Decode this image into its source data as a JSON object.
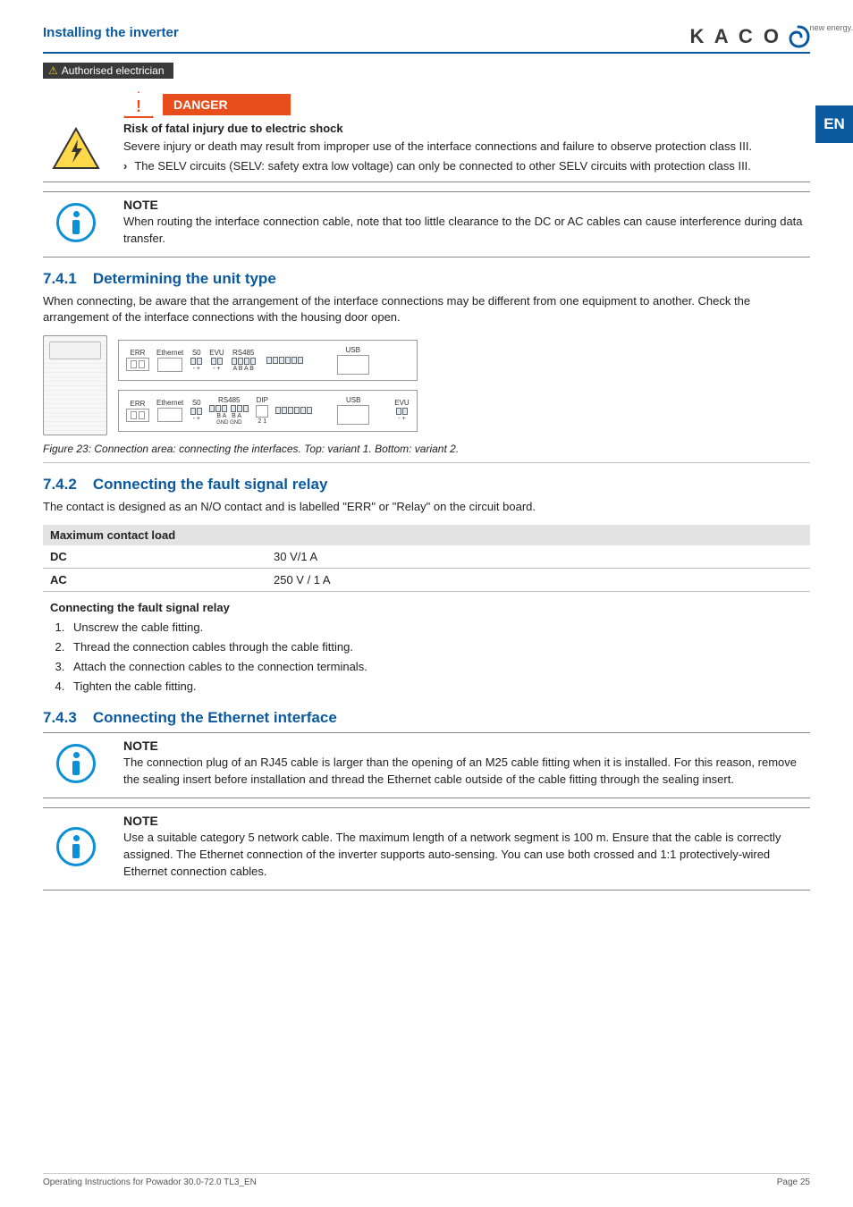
{
  "header": {
    "section_title": "Installing the inverter",
    "logo_text": "K A C O",
    "logo_sub": "new energy.",
    "lang_tab": "EN"
  },
  "auth_badge": "Authorised electrician",
  "danger": {
    "label": "DANGER",
    "heading": "Risk of fatal injury due to electric shock",
    "para": "Severe injury or death may result from improper use of the interface connections and failure to observe protection class III.",
    "bullet": "The SELV circuits (SELV: safety extra low voltage) can only be connected to other SELV circuits with protection class III."
  },
  "note_route": {
    "title": "NOTE",
    "text": "When routing the interface connection cable, note that too little clearance to the DC or AC cables can cause interference during data transfer."
  },
  "sec_741": {
    "num": "7.4.1",
    "title": "Determining the unit type",
    "para": "When connecting, be aware that the arrangement of the interface connections may be different from one equipment to another. Check the arrangement of the interface connections with the housing door open.",
    "fig_caption": "Figure 23: Connection area: connecting the interfaces. Top: variant 1. Bottom: variant 2.",
    "labels1": {
      "err": "ERR",
      "eth": "Ethernet",
      "s0": "S0",
      "evu": "EVU",
      "rs": "RS485",
      "usb": "USB",
      "sub": "-  +    -  +   A B A B"
    },
    "labels2": {
      "err": "ERR",
      "eth": "Ethernet",
      "s0": "S0",
      "rs": "RS485",
      "dip": "DIP",
      "usb": "USB",
      "evu": "EVU",
      "sub": "-  +    B A    B A   2  1",
      "gnd": "GND    GND",
      "evusub": "-  +"
    }
  },
  "sec_742": {
    "num": "7.4.2",
    "title": "Connecting the fault signal relay",
    "para": "The contact is designed as an N/O contact and is labelled \"ERR\" or \"Relay\" on the circuit board.",
    "table_head": "Maximum contact load",
    "row_dc_label": "DC",
    "row_dc_val": "30 V/1 A",
    "row_ac_label": "AC",
    "row_ac_val": "250 V / 1 A",
    "proc_head": "Connecting the fault signal relay",
    "steps": [
      "Unscrew the cable fitting.",
      "Thread the connection cables through the cable fitting.",
      "Attach the connection cables to the connection terminals.",
      "Tighten the cable fitting."
    ]
  },
  "sec_743": {
    "num": "7.4.3",
    "title": "Connecting the Ethernet interface",
    "note1_title": "NOTE",
    "note1_text": "The connection plug of an RJ45 cable is larger than the opening of an M25 cable fitting when it is installed. For this reason, remove the sealing insert before installation and thread the Ethernet cable outside of the cable fitting through the sealing insert.",
    "note2_title": "NOTE",
    "note2_text": "Use a suitable category 5 network cable. The maximum length of a network segment is 100 m. Ensure that the cable is correctly assigned. The Ethernet connection of the inverter supports auto-sensing. You can use both crossed and 1:1 protectively-wired Ethernet connection cables."
  },
  "footer": {
    "left": "Operating Instructions for Powador 30.0-72.0 TL3_EN",
    "right": "Page 25"
  }
}
